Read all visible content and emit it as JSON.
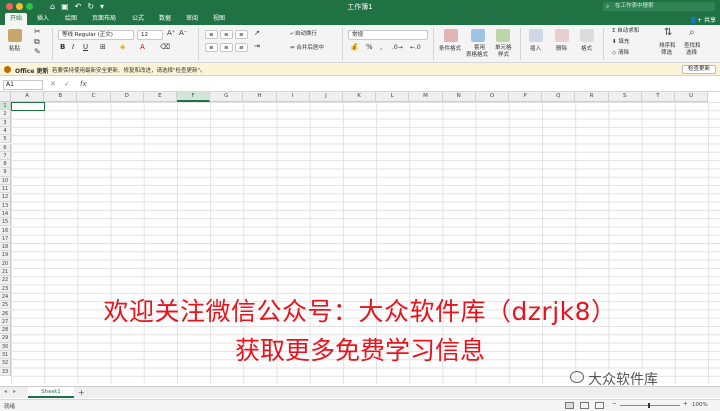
{
  "window": {
    "title": "工作簿1",
    "search_placeholder": "在工作表中搜索"
  },
  "ribbon_tabs": [
    "开始",
    "插入",
    "绘图",
    "页面布局",
    "公式",
    "数据",
    "审阅",
    "视图"
  ],
  "share_label": "共享",
  "ribbon": {
    "paste": "粘贴",
    "font_name": "等线 Regular (正文)",
    "font_size": "12",
    "wrap_text": "自动换行",
    "merge_center": "合并后居中",
    "number_format": "常规",
    "conditional_format": "条件格式",
    "table_format_1": "套用",
    "table_format_2": "表格格式",
    "cell_style_1": "单元格",
    "cell_style_2": "样式",
    "insert": "插入",
    "delete": "删除",
    "format": "格式",
    "autosum": "自动求和",
    "fill": "填充",
    "clear": "清除",
    "sort_filter_1": "排序和",
    "sort_filter_2": "筛选",
    "find_select_1": "查找和",
    "find_select_2": "选择"
  },
  "message_bar": {
    "title": "Office 更新",
    "text": "若要保持使用最新安全更新、修复和改进，请选择\"检查更新\"。",
    "button": "检查更新"
  },
  "formula_bar": {
    "name_box": "A1",
    "fx": "fx"
  },
  "columns": [
    "A",
    "B",
    "C",
    "D",
    "E",
    "F",
    "G",
    "H",
    "I",
    "J",
    "K",
    "L",
    "M",
    "N",
    "O",
    "P",
    "Q",
    "R",
    "S",
    "T",
    "U"
  ],
  "selected_column": "F",
  "rows": [
    "1",
    "2",
    "3",
    "4",
    "5",
    "6",
    "7",
    "8",
    "9",
    "10",
    "11",
    "12",
    "13",
    "14",
    "15",
    "16",
    "17",
    "18",
    "19",
    "20",
    "21",
    "22",
    "23",
    "24",
    "25",
    "26",
    "27",
    "28",
    "29",
    "30",
    "31",
    "32",
    "33"
  ],
  "overlay": {
    "line1": "欢迎关注微信公众号：大众软件库（dzrjk8）",
    "line2": "获取更多免费学习信息"
  },
  "watermark": "大众软件库",
  "sheet_tab": "Sheet1",
  "add_sheet": "+",
  "status": "就绪",
  "zoom": "100%",
  "colors": {
    "brand": "#207245",
    "overlay_red": "#e8141c"
  }
}
